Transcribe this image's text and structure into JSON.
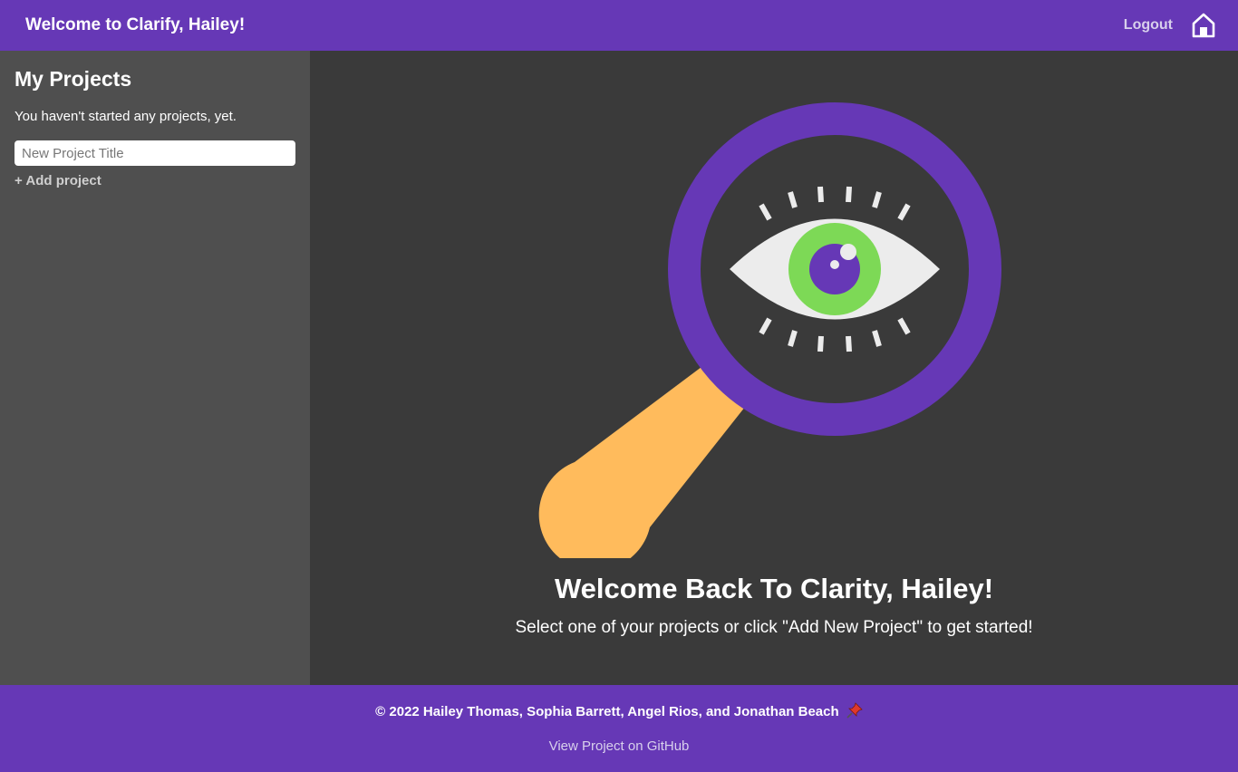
{
  "header": {
    "title": "Welcome to Clarify, Hailey!",
    "logout_label": "Logout",
    "home_icon": "home-icon"
  },
  "sidebar": {
    "heading": "My Projects",
    "empty_message": "You haven't started any projects, yet.",
    "new_project_placeholder": "New Project Title",
    "new_project_value": "",
    "add_project_label": "+ Add project"
  },
  "main": {
    "illustration_icon": "magnifier-eye-icon",
    "title": "Welcome Back To Clarity, Hailey!",
    "subtitle": "Select one of your projects or click \"Add New Project\" to get started!"
  },
  "footer": {
    "copyright": "© 2022 Hailey Thomas, Sophia Barrett, Angel Rios, and Jonathan Beach",
    "pin_icon": "pushpin-icon",
    "github_label": "View Project on GitHub"
  },
  "colors": {
    "brand_purple": "#6638b6",
    "sidebar_bg": "#4f4f4f",
    "main_bg": "#3a3a3a",
    "handle_orange": "#ffbb5c",
    "iris_green": "#7dd956"
  }
}
